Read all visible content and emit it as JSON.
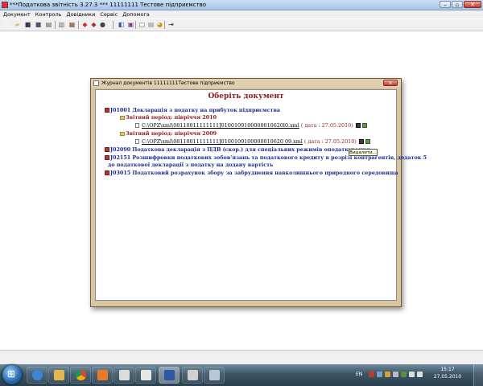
{
  "window": {
    "title": "***Податкова звітність 3.27.3 *** 11111111 Тестове підприємство",
    "controls": {
      "minimize": "–",
      "maximize": "▫",
      "close": "✕"
    }
  },
  "menu": {
    "items": [
      "Документ",
      "Контроль",
      "Довідники",
      "Сервіс",
      "Допомога"
    ]
  },
  "toolbar": {
    "buttons": [
      {
        "name": "new-document",
        "glyph": "▯",
        "color": "#ffffff"
      },
      {
        "name": "open-folder",
        "glyph": "▰",
        "color": "#e3c26b"
      },
      {
        "name": "save",
        "glyph": "■",
        "color": "#3a3a55"
      },
      {
        "name": "save-as",
        "glyph": "■",
        "color": "#555577"
      },
      {
        "name": "print",
        "glyph": "▤",
        "color": "#555555"
      },
      {
        "name": "journal",
        "glyph": "▥",
        "color": "#666666"
      },
      {
        "name": "preview",
        "glyph": "▦",
        "color": "#7a4b2a"
      },
      {
        "name": "check",
        "glyph": "◆",
        "color": "#c0392b"
      },
      {
        "name": "books",
        "glyph": "◆",
        "color": "#b03030"
      },
      {
        "name": "export",
        "glyph": "●",
        "color": "#444444"
      },
      {
        "name": "sign",
        "glyph": "◧",
        "color": "#2e5aa8"
      },
      {
        "name": "encrypt",
        "glyph": "▣",
        "color": "#7a3a8a"
      },
      {
        "name": "windows",
        "glyph": "▢",
        "color": "#666666"
      },
      {
        "name": "window-list",
        "glyph": "▤",
        "color": "#888888"
      },
      {
        "name": "refresh",
        "glyph": "◕",
        "color": "#c99a1a"
      },
      {
        "name": "exit",
        "glyph": "⇥",
        "color": "#333333"
      }
    ]
  },
  "dialog": {
    "title": "Журнал документів 11111111Тестове підприємство",
    "close_label": "✕",
    "header": "Оберіть документ",
    "tree": [
      {
        "code": "J01001",
        "title": "Декларація з податку на прибуток підприємства"
      },
      {
        "period": "Звітний період: півріччя 2010"
      },
      {
        "file": "C:\\OPZ\\xml\\08110011111111J0100109100000010620l0.xml",
        "date": "( дата : 27.05.2010)"
      },
      {
        "period": "Звітний період: півріччя 2009"
      },
      {
        "file": "C:\\OPZ\\xml\\08110011111111J0100109100000010620 09.xml",
        "date": "( дата : 27.05.2010)"
      },
      {
        "code": "J02090",
        "title": "Податкова декларація з ПДВ (скор.) для спеціальних режимів оподаткування"
      },
      {
        "code": "J02151",
        "title": "Розшифровки податкових зобов'язань та податкового кредиту в розрізі контрагентів, додаток 5",
        "title_cont": "до податкової декларації з податку на додану вартість"
      },
      {
        "code": "J03015",
        "title": "Податковий розрахунок збору за забруднення навколишнього природного середовища"
      }
    ],
    "tooltip": "Видалити..."
  },
  "taskbar": {
    "tray_lang": "EN",
    "time": "15:17",
    "date": "27.05.2010"
  },
  "colors": {
    "doc_title": "#1b2a8c",
    "period": "#8b1a1a",
    "dialog_frame": "#d9c6a0",
    "taskbar": "#2a3f4d"
  }
}
